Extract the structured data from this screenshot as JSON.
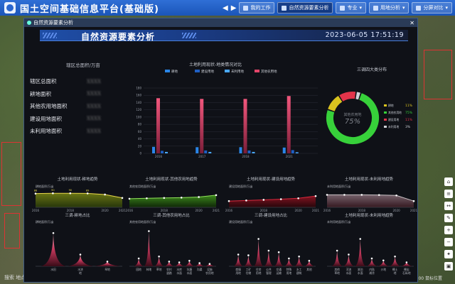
{
  "app": {
    "title": "国土空间基础信息平台(基础版)",
    "toolbar": [
      {
        "label": "我的工作",
        "active": false
      },
      {
        "label": "自然资源要素分析",
        "active": true
      },
      {
        "label": "专业",
        "active": false
      },
      {
        "label": "用地分析",
        "active": false
      },
      {
        "label": "分屏对比",
        "active": false
      }
    ],
    "status_left": "搜索 地点",
    "status_right": "比例尺: 1:500000   鼠标位置"
  },
  "window": {
    "title": "自然资源要素分析",
    "header_title": "自然资源要素分析",
    "datetime": "2023-06-05 17:51:19"
  },
  "area": {
    "title": "辖区总面积/万亩",
    "rows": [
      {
        "label": "辖区总面积",
        "value": "XXXX"
      },
      {
        "label": "耕地面积",
        "value": "XXXX"
      },
      {
        "label": "其他农用地面积",
        "value": "XXXX"
      },
      {
        "label": "建设用地面积",
        "value": "XXXX"
      },
      {
        "label": "未利用地面积",
        "value": "XXXX"
      }
    ]
  },
  "colors": {
    "gengdi": "#2a86e8",
    "jianshe": "#1f5fc4",
    "weili": "#4aa8ff",
    "qita": "#e3456a",
    "green": "#37d13a",
    "yellow": "#d9c31f",
    "red": "#e2344a",
    "gray": "#cfd2d8"
  },
  "chart_data": [
    {
      "type": "bar",
      "title": "土地利用现状-地类情况对比",
      "categories": [
        "2016",
        "2017",
        "2018",
        "2021"
      ],
      "ylim": [
        0,
        180
      ],
      "yticks": [
        "180",
        "160",
        "140",
        "120",
        "100",
        "80",
        "60",
        "40",
        "20",
        "0"
      ],
      "series": [
        {
          "name": "耕地",
          "values": [
            18,
            17,
            17,
            16
          ]
        },
        {
          "name": "建设用地",
          "values": [
            7,
            8,
            8,
            9
          ]
        },
        {
          "name": "未利用地",
          "values": [
            4,
            4,
            4,
            3
          ]
        },
        {
          "name": "其他农用地",
          "values": [
            152,
            150,
            150,
            158
          ]
        }
      ]
    },
    {
      "type": "pie",
      "title": "三调四大类分布",
      "center_label": "其他农用地",
      "center_value": "75%",
      "slices": [
        {
          "name": "其他农用地",
          "value": 75,
          "pct": "75%"
        },
        {
          "name": "耕地",
          "value": 11,
          "pct": "11%"
        },
        {
          "name": "建设用地",
          "value": 11,
          "pct": "11%"
        },
        {
          "name": "未利用地",
          "value": 3,
          "pct": "3%"
        }
      ]
    },
    {
      "type": "area",
      "title": "土地利用现状-耕地趋势",
      "ylabel": "耕地面积/万亩",
      "x": [
        "2016",
        "2017",
        "2018",
        "2019",
        "2020",
        "2021"
      ],
      "values": [
        88,
        90,
        90,
        89,
        82,
        60
      ],
      "labels": [
        "88",
        "90",
        "90",
        "89",
        "",
        ""
      ]
    },
    {
      "type": "area",
      "title": "土地利用现状-其他农用地趋势",
      "ylabel": "其他农用地面积/万亩",
      "x": [
        "2016",
        "2017",
        "2018",
        "2019",
        "2020",
        "2021"
      ],
      "values": [
        55,
        58,
        60,
        62,
        66,
        78
      ],
      "labels": [
        "",
        "",
        "",
        "",
        "",
        ""
      ]
    },
    {
      "type": "area",
      "title": "土地利用现状-建设用地趋势",
      "ylabel": "建设用地面积/万亩",
      "x": [
        "2016",
        "2017",
        "2018",
        "2019",
        "2020",
        "2021"
      ],
      "values": [
        40,
        44,
        48,
        52,
        58,
        72
      ],
      "labels": [
        "",
        "",
        "",
        "",
        "",
        ""
      ]
    },
    {
      "type": "area",
      "title": "土地利用现状-未利用地趋势",
      "ylabel": "未利用地面积/万亩",
      "x": [
        "2016",
        "2017",
        "2018",
        "2019",
        "2020",
        "2021"
      ],
      "values": [
        80,
        80,
        80,
        79,
        76,
        40
      ],
      "labels": [
        "",
        "",
        "",
        "",
        "",
        ""
      ]
    },
    {
      "type": "area",
      "title": "三调-耕地占比",
      "ylabel": "耕地面积/万亩",
      "categories": [
        "水田",
        "水浇地",
        "旱地"
      ],
      "values": [
        85,
        30,
        12
      ]
    },
    {
      "type": "area",
      "title": "三调-其他农用地占比",
      "ylabel": "其他农用地面积/万亩",
      "categories": [
        "园地",
        "林地",
        "草地",
        "农村道路",
        "水库水面",
        "坑塘水面",
        "沟渠",
        "设施农用地"
      ],
      "values": [
        20,
        90,
        25,
        12,
        10,
        14,
        8,
        6
      ]
    },
    {
      "type": "area",
      "title": "三调-建设用地占比",
      "ylabel": "建设用地面积/万亩",
      "categories": [
        "商服用地",
        "工矿仓储",
        "住宅用地",
        "公共管理",
        "交通运输",
        "特殊用地",
        "水工建筑",
        "其他"
      ],
      "values": [
        30,
        28,
        70,
        40,
        36,
        20,
        25,
        14
      ]
    },
    {
      "type": "area",
      "title": "土地利用现状-未利用地趋势",
      "ylabel": "未利用地面积/万亩",
      "categories": [
        "其他草地",
        "河流水面",
        "湖泊水面",
        "内陆滩涂",
        "沙地",
        "裸土地",
        "裸岩石砾地"
      ],
      "values": [
        40,
        30,
        70,
        20,
        15,
        25,
        10
      ]
    }
  ]
}
